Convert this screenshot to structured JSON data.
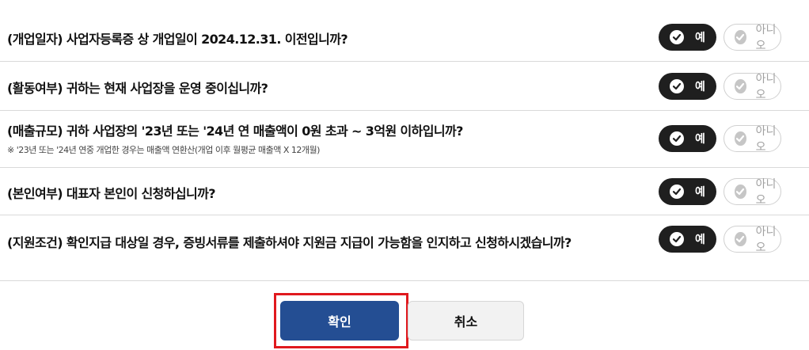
{
  "questions": [
    {
      "text": "(개업일자) 사업자등록증 상 개업일이 2024.12.31. 이전입니까?",
      "note": "",
      "yes_label": "예",
      "no_label": "아니오",
      "selected": "yes"
    },
    {
      "text": "(활동여부) 귀하는 현재 사업장을 운영 중이십니까?",
      "note": "",
      "yes_label": "예",
      "no_label": "아니오",
      "selected": "yes"
    },
    {
      "text": "(매출규모) 귀하 사업장의 '23년 또는 '24년 연 매출액이 0원 초과 ~ 3억원 이하입니까?",
      "note": "※ '23년 또는 '24년 연중 개업한 경우는 매출액 연환산(개업 이후 월평균 매출액 X 12개월)",
      "yes_label": "예",
      "no_label": "아니오",
      "selected": "yes"
    },
    {
      "text": "(본인여부) 대표자 본인이 신청하십니까?",
      "note": "",
      "yes_label": "예",
      "no_label": "아니오",
      "selected": "yes"
    },
    {
      "text": "(지원조건) 확인지급 대상일 경우, 증빙서류를 제출하셔야 지원금 지급이 가능함을 인지하고 신청하시겠습니까?",
      "note": "",
      "yes_label": "예",
      "no_label": "아니오",
      "selected": "yes"
    }
  ],
  "actions": {
    "confirm_label": "확인",
    "cancel_label": "취소"
  },
  "colors": {
    "selected_bg": "#1f1f1f",
    "confirm_bg": "#244e93",
    "highlight": "#e0191e"
  }
}
